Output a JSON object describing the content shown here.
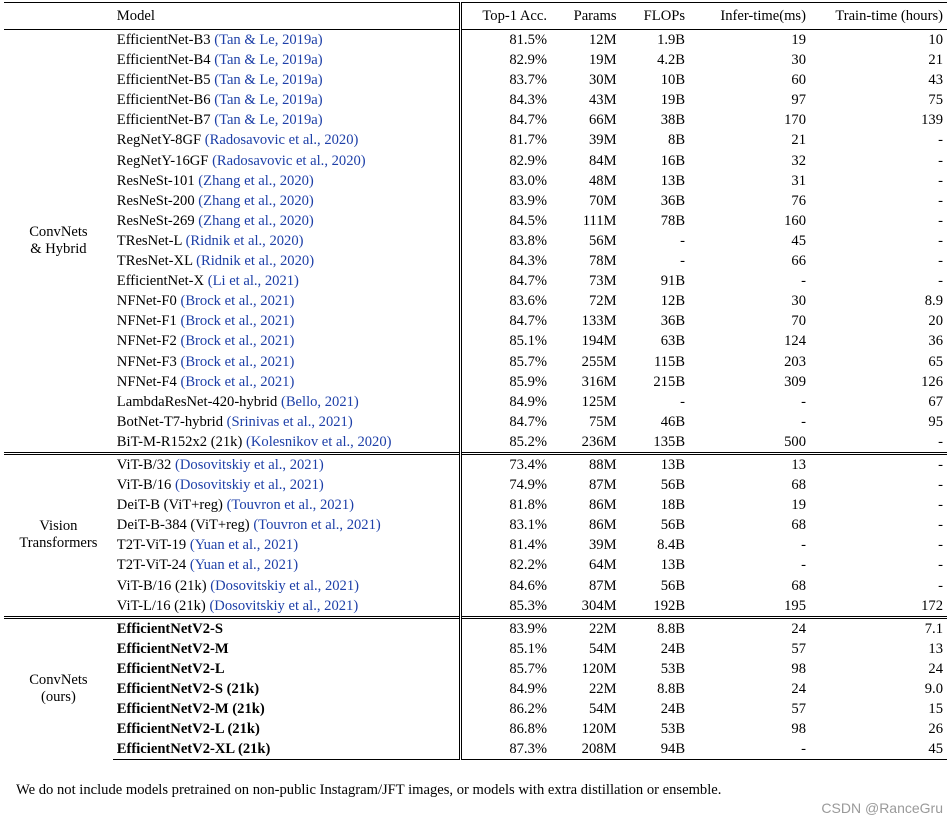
{
  "headers": {
    "model": "Model",
    "top1": "Top-1 Acc.",
    "params": "Params",
    "flops": "FLOPs",
    "infer": "Infer-time(ms)",
    "train": "Train-time (hours)"
  },
  "groups": [
    {
      "label1": "ConvNets",
      "label2": "& Hybrid",
      "rows": [
        {
          "name": "EfficientNet-B3",
          "cite": "(Tan & Le, 2019a)",
          "top1": "81.5%",
          "params": "12M",
          "flops": "1.9B",
          "infer": "19",
          "train": "10"
        },
        {
          "name": "EfficientNet-B4",
          "cite": "(Tan & Le, 2019a)",
          "top1": "82.9%",
          "params": "19M",
          "flops": "4.2B",
          "infer": "30",
          "train": "21"
        },
        {
          "name": "EfficientNet-B5",
          "cite": "(Tan & Le, 2019a)",
          "top1": "83.7%",
          "params": "30M",
          "flops": "10B",
          "infer": "60",
          "train": "43"
        },
        {
          "name": "EfficientNet-B6",
          "cite": "(Tan & Le, 2019a)",
          "top1": "84.3%",
          "params": "43M",
          "flops": "19B",
          "infer": "97",
          "train": "75"
        },
        {
          "name": "EfficientNet-B7",
          "cite": "(Tan & Le, 2019a)",
          "top1": "84.7%",
          "params": "66M",
          "flops": "38B",
          "infer": "170",
          "train": "139"
        },
        {
          "name": "RegNetY-8GF",
          "cite": "(Radosavovic et al., 2020)",
          "top1": "81.7%",
          "params": "39M",
          "flops": "8B",
          "infer": "21",
          "train": "-"
        },
        {
          "name": "RegNetY-16GF",
          "cite": "(Radosavovic et al., 2020)",
          "top1": "82.9%",
          "params": "84M",
          "flops": "16B",
          "infer": "32",
          "train": "-"
        },
        {
          "name": "ResNeSt-101",
          "cite": "(Zhang et al., 2020)",
          "top1": "83.0%",
          "params": "48M",
          "flops": "13B",
          "infer": "31",
          "train": "-"
        },
        {
          "name": "ResNeSt-200",
          "cite": "(Zhang et al., 2020)",
          "top1": "83.9%",
          "params": "70M",
          "flops": "36B",
          "infer": "76",
          "train": "-"
        },
        {
          "name": "ResNeSt-269",
          "cite": "(Zhang et al., 2020)",
          "top1": "84.5%",
          "params": "111M",
          "flops": "78B",
          "infer": "160",
          "train": "-"
        },
        {
          "name": "TResNet-L",
          "cite": "(Ridnik et al., 2020)",
          "top1": "83.8%",
          "params": "56M",
          "flops": "-",
          "infer": "45",
          "train": "-"
        },
        {
          "name": "TResNet-XL",
          "cite": "(Ridnik et al., 2020)",
          "top1": "84.3%",
          "params": "78M",
          "flops": "-",
          "infer": "66",
          "train": "-"
        },
        {
          "name": "EfficientNet-X",
          "cite": "(Li et al., 2021)",
          "top1": "84.7%",
          "params": "73M",
          "flops": "91B",
          "infer": "-",
          "train": "-"
        },
        {
          "name": "NFNet-F0",
          "cite": "(Brock et al., 2021)",
          "top1": "83.6%",
          "params": "72M",
          "flops": "12B",
          "infer": "30",
          "train": "8.9"
        },
        {
          "name": "NFNet-F1",
          "cite": "(Brock et al., 2021)",
          "top1": "84.7%",
          "params": "133M",
          "flops": "36B",
          "infer": "70",
          "train": "20"
        },
        {
          "name": "NFNet-F2",
          "cite": "(Brock et al., 2021)",
          "top1": "85.1%",
          "params": "194M",
          "flops": "63B",
          "infer": "124",
          "train": "36"
        },
        {
          "name": "NFNet-F3",
          "cite": "(Brock et al., 2021)",
          "top1": "85.7%",
          "params": "255M",
          "flops": "115B",
          "infer": "203",
          "train": "65"
        },
        {
          "name": "NFNet-F4",
          "cite": "(Brock et al., 2021)",
          "top1": "85.9%",
          "params": "316M",
          "flops": "215B",
          "infer": "309",
          "train": "126"
        },
        {
          "name": "LambdaResNet-420-hybrid",
          "cite": "(Bello, 2021)",
          "top1": "84.9%",
          "params": "125M",
          "flops": "-",
          "infer": "-",
          "train": "67"
        },
        {
          "name": "BotNet-T7-hybrid",
          "cite": "(Srinivas et al., 2021)",
          "top1": "84.7%",
          "params": "75M",
          "flops": "46B",
          "infer": "-",
          "train": "95"
        },
        {
          "name": "BiT-M-R152x2 (21k)",
          "cite": "(Kolesnikov et al., 2020)",
          "top1": "85.2%",
          "params": "236M",
          "flops": "135B",
          "infer": "500",
          "train": "-"
        }
      ]
    },
    {
      "label1": "Vision",
      "label2": "Transformers",
      "rows": [
        {
          "name": "ViT-B/32",
          "cite": "(Dosovitskiy et al., 2021)",
          "top1": "73.4%",
          "params": "88M",
          "flops": "13B",
          "infer": "13",
          "train": "-"
        },
        {
          "name": "ViT-B/16",
          "cite": "(Dosovitskiy et al., 2021)",
          "top1": "74.9%",
          "params": "87M",
          "flops": "56B",
          "infer": "68",
          "train": "-"
        },
        {
          "name": "DeiT-B (ViT+reg)",
          "cite": "(Touvron et al., 2021)",
          "top1": "81.8%",
          "params": "86M",
          "flops": "18B",
          "infer": "19",
          "train": "-"
        },
        {
          "name": "DeiT-B-384 (ViT+reg)",
          "cite": "(Touvron et al., 2021)",
          "top1": "83.1%",
          "params": "86M",
          "flops": "56B",
          "infer": "68",
          "train": "-"
        },
        {
          "name": "T2T-ViT-19",
          "cite": "(Yuan et al., 2021)",
          "top1": "81.4%",
          "params": "39M",
          "flops": "8.4B",
          "infer": "-",
          "train": "-"
        },
        {
          "name": "T2T-ViT-24",
          "cite": "(Yuan et al., 2021)",
          "top1": "82.2%",
          "params": "64M",
          "flops": "13B",
          "infer": "-",
          "train": "-"
        },
        {
          "name": "ViT-B/16 (21k)",
          "cite": "(Dosovitskiy et al., 2021)",
          "top1": "84.6%",
          "params": "87M",
          "flops": "56B",
          "infer": "68",
          "train": "-"
        },
        {
          "name": "ViT-L/16 (21k)",
          "cite": "(Dosovitskiy et al., 2021)",
          "top1": "85.3%",
          "params": "304M",
          "flops": "192B",
          "infer": "195",
          "train": "172"
        }
      ]
    },
    {
      "label1": "ConvNets",
      "label2": "(ours)",
      "bold": true,
      "rows": [
        {
          "name": "EfficientNetV2-S",
          "cite": "",
          "top1": "83.9%",
          "params": "22M",
          "flops": "8.8B",
          "infer": "24",
          "train": "7.1"
        },
        {
          "name": "EfficientNetV2-M",
          "cite": "",
          "top1": "85.1%",
          "params": "54M",
          "flops": "24B",
          "infer": "57",
          "train": "13"
        },
        {
          "name": "EfficientNetV2-L",
          "cite": "",
          "top1": "85.7%",
          "params": "120M",
          "flops": "53B",
          "infer": "98",
          "train": "24"
        },
        {
          "name": "EfficientNetV2-S (21k)",
          "cite": "",
          "top1": "84.9%",
          "params": "22M",
          "flops": "8.8B",
          "infer": "24",
          "train": "9.0"
        },
        {
          "name": "EfficientNetV2-M (21k)",
          "cite": "",
          "top1": "86.2%",
          "params": "54M",
          "flops": "24B",
          "infer": "57",
          "train": "15"
        },
        {
          "name": "EfficientNetV2-L (21k)",
          "cite": "",
          "top1": "86.8%",
          "params": "120M",
          "flops": "53B",
          "infer": "98",
          "train": "26"
        },
        {
          "name": "EfficientNetV2-XL (21k)",
          "cite": "",
          "top1": "87.3%",
          "params": "208M",
          "flops": "94B",
          "infer": "-",
          "train": "45"
        }
      ]
    }
  ],
  "footnote": "We do not include models pretrained on non-public Instagram/JFT images, or models with extra distillation or ensemble.",
  "watermark": "CSDN @RanceGru"
}
